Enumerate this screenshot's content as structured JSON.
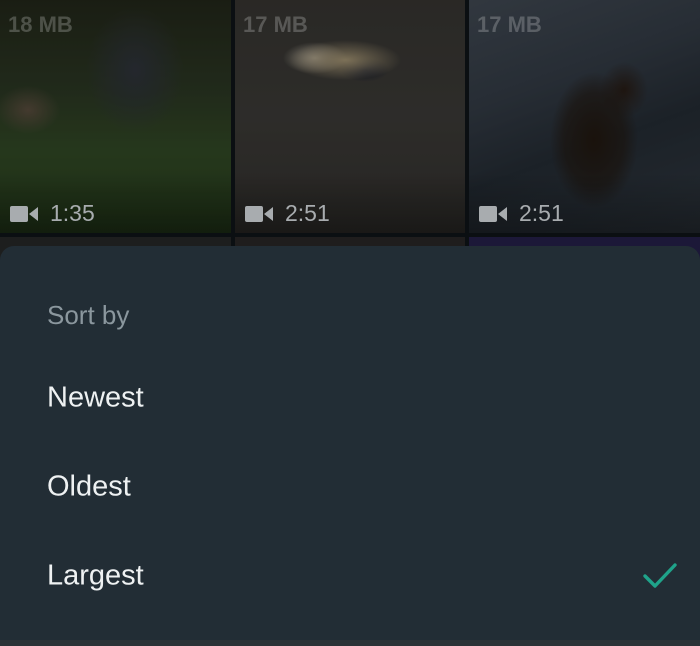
{
  "gallery": {
    "tiles": [
      {
        "size": "18 MB",
        "duration": "1:35"
      },
      {
        "size": "17 MB",
        "duration": "2:51"
      },
      {
        "size": "17 MB",
        "duration": "2:51"
      }
    ]
  },
  "sort_sheet": {
    "title": "Sort by",
    "options": [
      {
        "label": "Newest",
        "selected": false
      },
      {
        "label": "Oldest",
        "selected": false
      },
      {
        "label": "Largest",
        "selected": true
      }
    ],
    "accent_color": "#1fa38a",
    "background_color": "#222d35"
  },
  "icons": {
    "video": "video-camera-icon",
    "check": "checkmark-icon"
  }
}
